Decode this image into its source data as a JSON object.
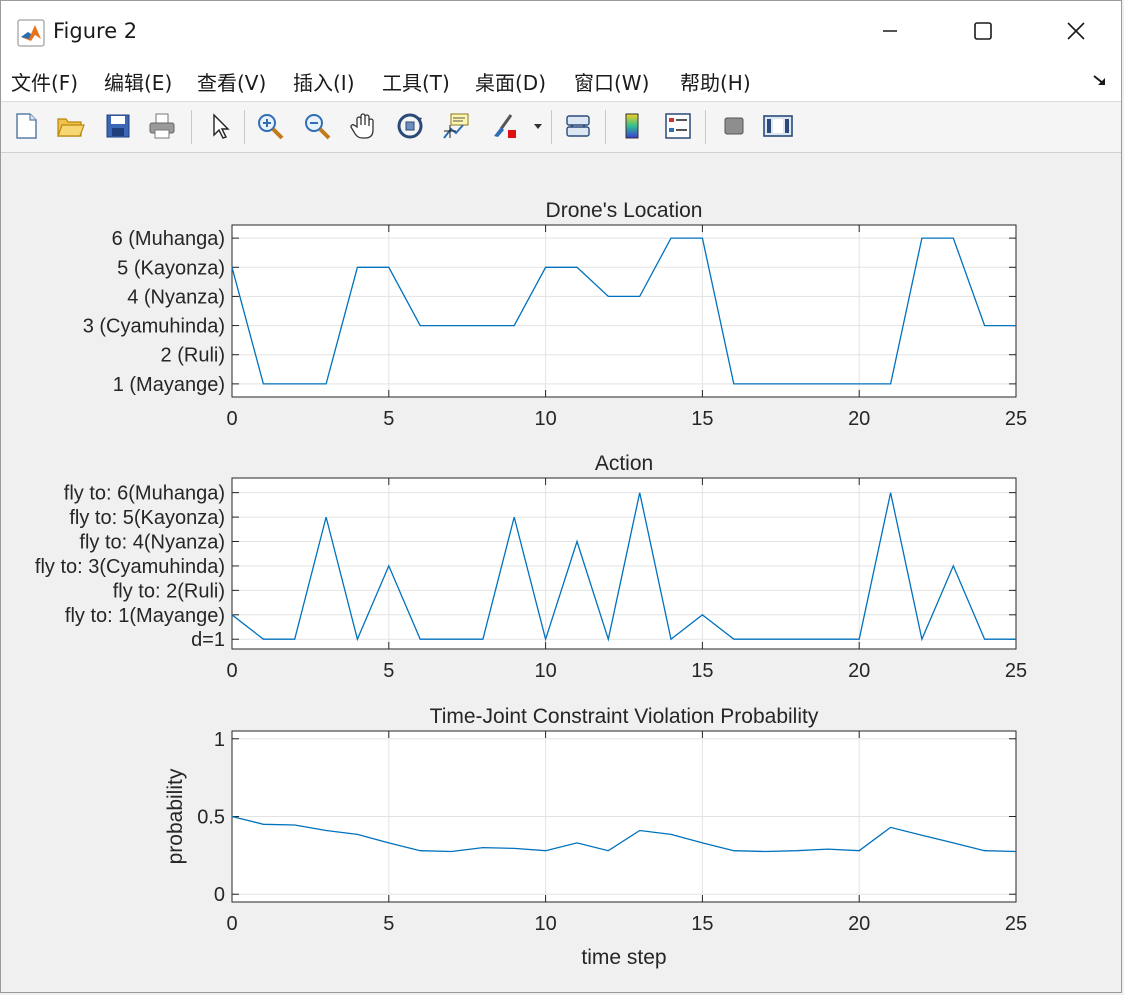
{
  "window": {
    "title": "Figure 2"
  },
  "menu": [
    {
      "label": "文件(F)"
    },
    {
      "label": "编辑(E)"
    },
    {
      "label": "查看(V)"
    },
    {
      "label": "插入(I)"
    },
    {
      "label": "工具(T)"
    },
    {
      "label": "桌面(D)"
    },
    {
      "label": "窗口(W)"
    },
    {
      "label": "帮助(H)"
    }
  ],
  "toolbar": [
    "new-figure-icon",
    "open-file-icon",
    "save-icon",
    "print-icon",
    "edit-plot-arrow-icon",
    "zoom-in-icon",
    "zoom-out-icon",
    "pan-hand-icon",
    "rotate-3d-icon",
    "data-cursor-icon",
    "brush-icon",
    "link-plot-icon",
    "colorbar-icon",
    "legend-icon",
    "hide-plot-tools-icon",
    "show-plot-tools-icon"
  ],
  "colors": {
    "line": "#0072bd",
    "grid": "#e3e3e3",
    "axes": "#262626"
  },
  "charts": [
    {
      "type": "line",
      "title": "Drone's Location",
      "xlabel": "",
      "ylabel": "",
      "xlim": [
        0,
        25
      ],
      "ylim": [
        0.55,
        6.45
      ],
      "xticks": [
        0,
        5,
        10,
        15,
        20,
        25
      ],
      "yticks": [
        1,
        2,
        3,
        4,
        5,
        6
      ],
      "yticklabels": [
        "1 (Mayange)",
        "2 (Ruli)",
        "3 (Cyamuhinda)",
        "4 (Nyanza)",
        "5 (Kayonza)",
        "6 (Muhanga)"
      ],
      "grid": true,
      "x": [
        0,
        1,
        2,
        3,
        4,
        5,
        6,
        7,
        8,
        9,
        10,
        11,
        12,
        13,
        14,
        15,
        16,
        17,
        18,
        19,
        20,
        21,
        22,
        23,
        24,
        25
      ],
      "y": [
        5,
        1,
        1,
        1,
        5,
        5,
        3,
        3,
        3,
        3,
        5,
        5,
        4,
        4,
        6,
        6,
        1,
        1,
        1,
        1,
        1,
        1,
        6,
        6,
        3,
        3
      ]
    },
    {
      "type": "line",
      "title": "Action",
      "xlabel": "",
      "ylabel": "",
      "xlim": [
        0,
        25
      ],
      "ylim": [
        -0.4,
        6.6
      ],
      "xticks": [
        0,
        5,
        10,
        15,
        20,
        25
      ],
      "yticks": [
        0,
        1,
        2,
        3,
        4,
        5,
        6
      ],
      "yticklabels": [
        "d=1",
        "fly to: 1(Mayange)",
        "fly to: 2(Ruli)",
        "fly to: 3(Cyamuhinda)",
        "fly to: 4(Nyanza)",
        "fly to: 5(Kayonza)",
        "fly to: 6(Muhanga)"
      ],
      "grid": true,
      "x": [
        0,
        1,
        2,
        3,
        4,
        5,
        6,
        7,
        8,
        9,
        10,
        11,
        12,
        13,
        14,
        15,
        16,
        17,
        18,
        19,
        20,
        21,
        22,
        23,
        24,
        25
      ],
      "y": [
        1,
        0,
        0,
        5,
        0,
        3,
        0,
        0,
        0,
        5,
        0,
        4,
        0,
        6,
        0,
        1,
        0,
        0,
        0,
        0,
        0,
        6,
        0,
        3,
        0,
        0
      ]
    },
    {
      "type": "line",
      "title": "Time-Joint Constraint Violation Probability",
      "xlabel": "time step",
      "ylabel": "probability",
      "xlim": [
        0,
        25
      ],
      "ylim": [
        -0.05,
        1.05
      ],
      "xticks": [
        0,
        5,
        10,
        15,
        20,
        25
      ],
      "yticks": [
        0,
        0.5,
        1
      ],
      "yticklabels": [
        "0",
        "0.5",
        "1"
      ],
      "grid": true,
      "x": [
        0,
        1,
        2,
        3,
        4,
        5,
        6,
        7,
        8,
        9,
        10,
        11,
        12,
        13,
        14,
        15,
        16,
        17,
        18,
        19,
        20,
        21,
        22,
        23,
        24,
        25
      ],
      "y": [
        0.5,
        0.45,
        0.445,
        0.41,
        0.385,
        0.33,
        0.28,
        0.275,
        0.3,
        0.295,
        0.28,
        0.33,
        0.28,
        0.41,
        0.385,
        0.33,
        0.28,
        0.275,
        0.28,
        0.29,
        0.28,
        0.43,
        0.38,
        0.33,
        0.28,
        0.275
      ]
    }
  ]
}
